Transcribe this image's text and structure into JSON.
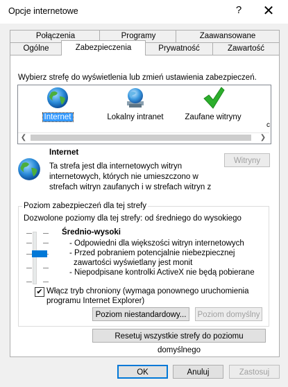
{
  "window": {
    "title": "Opcje internetowe",
    "help_glyph": "?",
    "close_glyph": "✕"
  },
  "tabs_row1": [
    "Połączenia",
    "Programy",
    "Zaawansowane"
  ],
  "tabs_row2": [
    "Ogólne",
    "Zabezpieczenia",
    "Prywatność",
    "Zawartość"
  ],
  "active_tab": "Zabezpieczenia",
  "zone_prompt": "Wybierz strefę do wyświetlenia lub zmień ustawienia zabezpieczeń.",
  "zones": [
    {
      "label": "Internet",
      "icon": "globe-icon",
      "selected": true
    },
    {
      "label": "Lokalny intranet",
      "icon": "intranet-globe-icon",
      "selected": false
    },
    {
      "label": "Zaufane witryny",
      "icon": "checkmark-icon",
      "selected": false
    },
    {
      "label": "c",
      "icon": "",
      "selected": false
    }
  ],
  "zone_info": {
    "name": "Internet",
    "description": [
      "Ta strefa jest dla internetowych witryn",
      "internetowych, których nie umieszczono w",
      "strefach witryn zaufanych i w strefach witryn z"
    ],
    "sites_button": "Witryny"
  },
  "security_level": {
    "group_label": "Poziom zabezpieczeń dla tej strefy",
    "allowed": "Dozwolone poziomy dla tej strefy: od średniego do wysokiego",
    "level_name": "Średnio-wysoki",
    "bullets": [
      "- Odpowiedni dla większości witryn internetowych",
      "- Przed pobraniem potencjalnie niebezpiecznej",
      "  zawartości wyświetlany jest monit",
      "- Niepodpisane kontrolki ActiveX nie będą pobierane"
    ],
    "protected_mode_checked": true,
    "protected_mode": [
      "Włącz tryb chroniony (wymaga ponownego uruchomienia",
      "programu Internet Explorer)"
    ],
    "custom_button": "Poziom niestandardowy...",
    "default_button": "Poziom domyślny"
  },
  "reset_all_button": "Resetuj wszystkie strefy do poziomu domyślnego",
  "footer": {
    "ok": "OK",
    "cancel": "Anuluj",
    "apply": "Zastosuj"
  },
  "colors": {
    "accent": "#0078d7",
    "selection": "#3399ff",
    "check_green": "#2cae2c"
  }
}
